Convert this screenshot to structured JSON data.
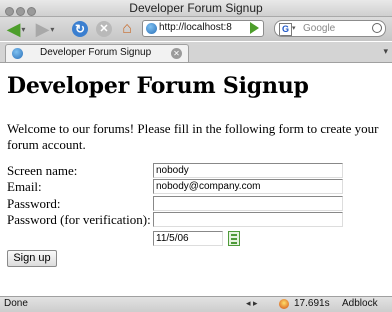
{
  "window": {
    "title": "Developer Forum Signup"
  },
  "toolbar": {
    "url": "http://localhost:8",
    "search_placeholder": "Google",
    "search_engine_letter": "G"
  },
  "tab": {
    "label": "Developer Forum Signup"
  },
  "page": {
    "heading": "Developer Forum Signup",
    "intro": "Welcome to our forums! Please fill in the following form to create your forum account.",
    "form": {
      "screen_name_label": "Screen name:",
      "screen_name_value": "nobody",
      "email_label": "Email:",
      "email_value": "nobody@company.com",
      "password_label": "Password:",
      "password_value": "",
      "password_verify_label": "Password (for verification):",
      "password_verify_value": "",
      "date_value": "11/5/06",
      "submit_label": "Sign up"
    }
  },
  "status": {
    "left": "Done",
    "timer": "17.691s",
    "adblock": "Adblock"
  },
  "icons": {
    "back": "back-arrow-icon",
    "forward": "forward-arrow-icon",
    "reload": "reload-icon",
    "stop": "stop-icon",
    "home": "home-icon",
    "calendar": "calendar-icon"
  },
  "colors": {
    "green_accent": "#4d9e2b",
    "reload_blue": "#3b7fd0"
  }
}
